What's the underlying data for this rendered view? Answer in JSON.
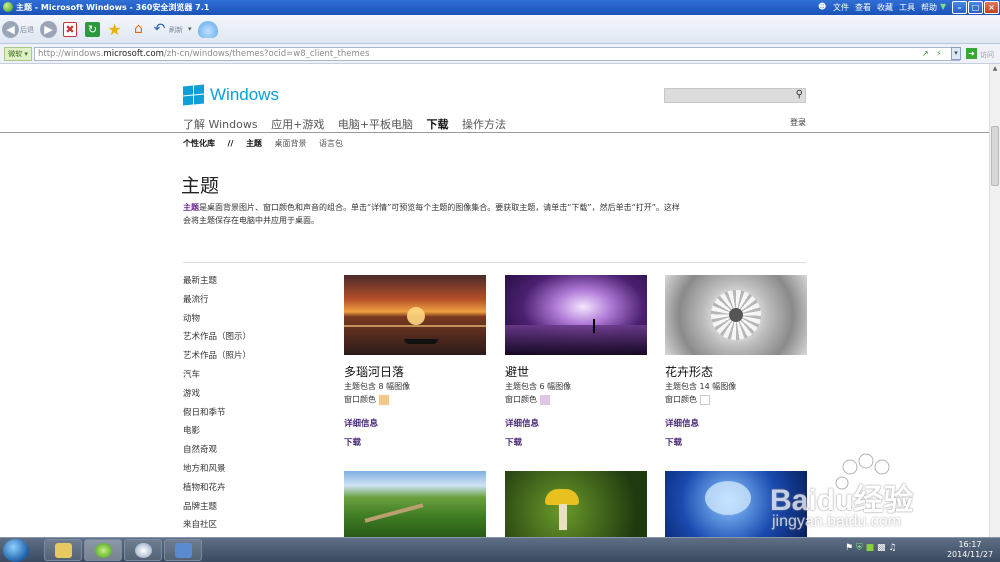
{
  "window": {
    "title": "主题 - Microsoft Windows - 360安全浏览器 7.1",
    "menus": [
      "文件",
      "查看",
      "收藏",
      "工具",
      "帮助"
    ],
    "controls": {
      "minimize": "–",
      "maximize": "□",
      "close": "×"
    }
  },
  "toolbar": {
    "back_label": "后退",
    "refresh_label": "刷新"
  },
  "address": {
    "dropdown_label": "微软",
    "url_prefix": "http://windows.",
    "url_domain": "microsoft.com",
    "url_suffix": "/zh-cn/windows/themes?ocid=w8_client_themes",
    "go_label": "访问"
  },
  "site": {
    "logo_text": "Windows",
    "nav": [
      "了解 Windows",
      "应用+游戏",
      "电脑+平板电脑",
      "下载",
      "操作方法"
    ],
    "nav_active_index": 3,
    "login_label": "登录",
    "subnav": [
      "个性化库",
      "//",
      "主题",
      "桌面背景",
      "语言包"
    ]
  },
  "page": {
    "title": "主题",
    "desc_highlight": "主题",
    "desc_rest": "是桌面背景图片、窗口颜色和声音的组合。单击“详情”可预览每个主题的图像集合。要获取主题，请单击“下载”，然后单击“打开”。这样会将主题保存在电脑中并应用于桌面。"
  },
  "sidebar": {
    "items": [
      "最新主题",
      "最流行",
      "动物",
      "艺术作品（图示）",
      "艺术作品（照片）",
      "汽车",
      "游戏",
      "假日和季节",
      "电影",
      "自然奇观",
      "地方和风景",
      "植物和花卉",
      "品牌主题",
      "来自社区"
    ]
  },
  "themes": [
    {
      "name": "多瑙河日落",
      "count": "主题包含 8 幅图像",
      "color_label": "窗口颜色",
      "color": "#f3c98a",
      "details": "详细信息",
      "download": "下载"
    },
    {
      "name": "避世",
      "count": "主题包含 6 幅图像",
      "color_label": "窗口颜色",
      "color": "#dcc7e6",
      "details": "详细信息",
      "download": "下载"
    },
    {
      "name": "花卉形态",
      "count": "主题包含 14 幅图像",
      "color_label": "窗口颜色",
      "color": "#ffffff",
      "details": "详细信息",
      "download": "下载"
    }
  ],
  "watermark": {
    "big": "Baidu经验",
    "small": "jingyan.baidu.com"
  },
  "taskbar": {
    "time": "16:17",
    "date": "2014/11/27"
  }
}
